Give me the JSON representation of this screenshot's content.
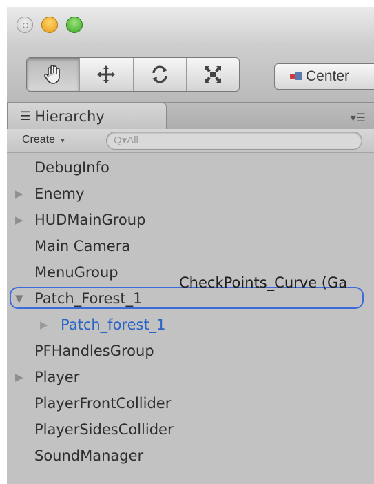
{
  "toolbar": {
    "tools": [
      "hand-icon",
      "move-icon",
      "rotate-icon",
      "scale-icon"
    ],
    "active_tool": "hand-icon",
    "center_label": "Center"
  },
  "panel": {
    "tab_label": "Hierarchy",
    "create_label": "Create",
    "search_placeholder": "Q▾All"
  },
  "hierarchy": [
    {
      "name": "DebugInfo",
      "expandable": false
    },
    {
      "name": "Enemy",
      "expandable": true
    },
    {
      "name": "HUDMainGroup",
      "expandable": true
    },
    {
      "name": "Main Camera",
      "expandable": false
    },
    {
      "name": "MenuGroup",
      "expandable": false
    },
    {
      "name": "Patch_Forest_1",
      "expandable": true,
      "expanded": true,
      "highlighted": true
    },
    {
      "name": "Patch_forest_1",
      "expandable": true,
      "child": true
    },
    {
      "name": "PFHandlesGroup",
      "expandable": false
    },
    {
      "name": "Player",
      "expandable": true
    },
    {
      "name": "PlayerFrontCollider",
      "expandable": false
    },
    {
      "name": "PlayerSidesCollider",
      "expandable": false
    },
    {
      "name": "SoundManager",
      "expandable": false
    }
  ],
  "drag_ghost_label": "CheckPoints_Curve (Ga",
  "colors": {
    "highlight_ring": "#3b6bdc",
    "child_text": "#2a64c5"
  }
}
